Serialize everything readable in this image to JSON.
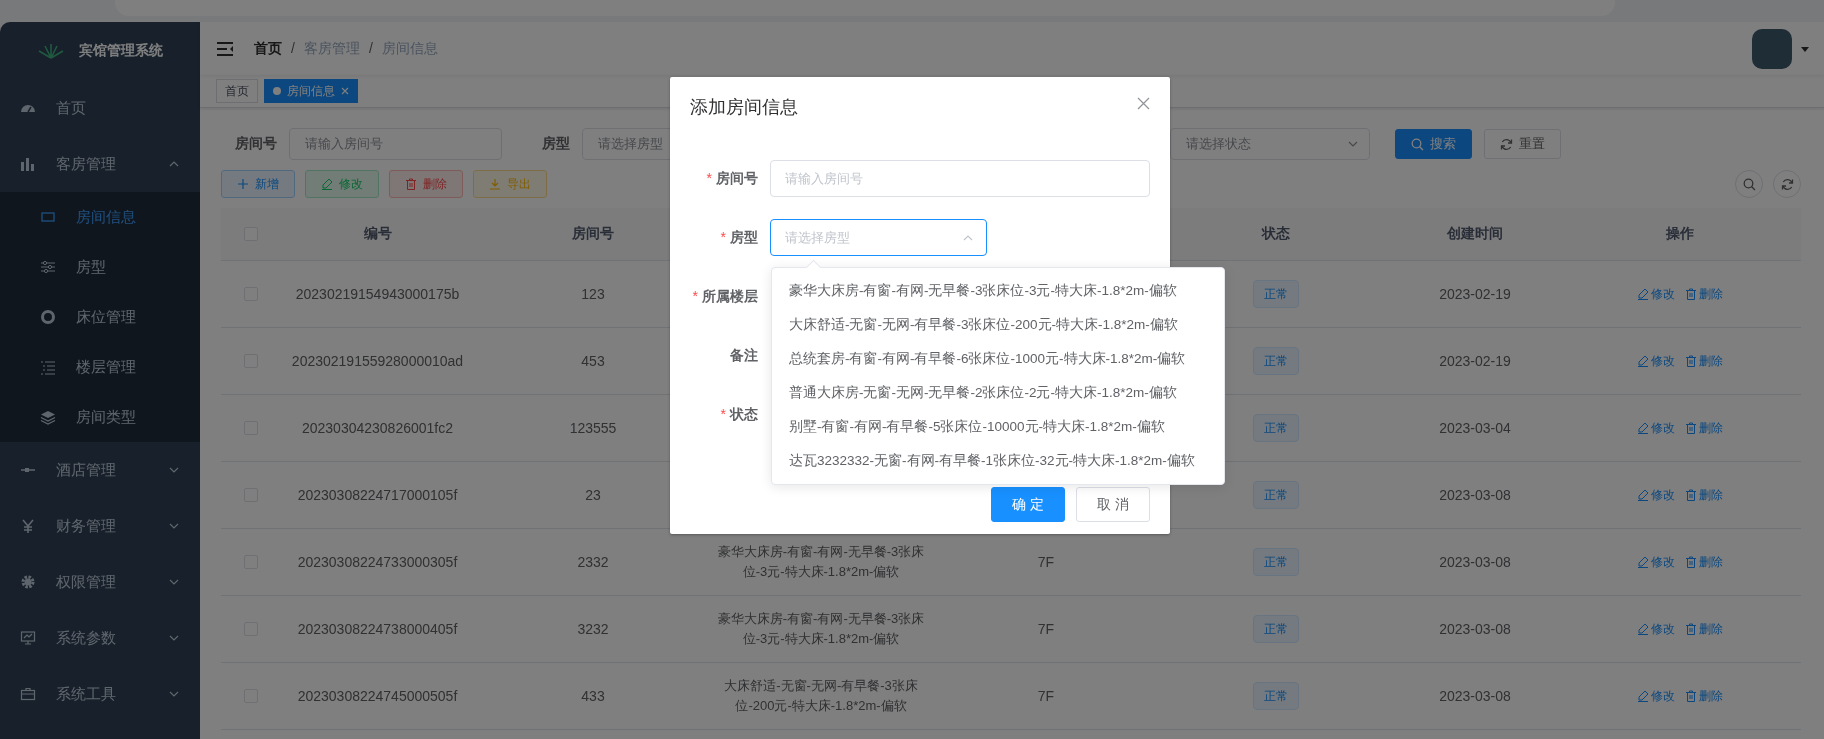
{
  "sidebar": {
    "title": "宾馆管理系统",
    "items": [
      {
        "label": "首页",
        "selected": false
      },
      {
        "label": "客房管理",
        "expanded": true,
        "children": [
          {
            "label": "房间信息",
            "selected": true
          },
          {
            "label": "房型",
            "selected": false
          },
          {
            "label": "床位管理",
            "selected": false
          },
          {
            "label": "楼层管理",
            "selected": false
          },
          {
            "label": "房间类型",
            "selected": false
          }
        ]
      },
      {
        "label": "酒店管理",
        "expanded": false
      },
      {
        "label": "财务管理",
        "expanded": false
      },
      {
        "label": "权限管理",
        "expanded": false
      },
      {
        "label": "系统参数",
        "expanded": false
      },
      {
        "label": "系统工具",
        "expanded": false
      }
    ]
  },
  "header": {
    "breadcrumb": [
      "首页",
      "客房管理",
      "房间信息"
    ],
    "separators": [
      "/",
      "/"
    ]
  },
  "tabs": [
    {
      "label": "首页",
      "selected": false
    },
    {
      "label": "房间信息",
      "selected": true
    }
  ],
  "filters": {
    "fields": [
      {
        "label": "房间号",
        "kind": "input",
        "placeholder": "请输入房间号"
      },
      {
        "label": "房型",
        "kind": "select",
        "placeholder": "请选择房型"
      },
      {
        "kind": "select",
        "placeholder": "请选择状态"
      }
    ],
    "buttons": [
      {
        "label": "搜索",
        "kind": "primary"
      },
      {
        "label": "重置",
        "kind": "default"
      }
    ]
  },
  "toolbar": [
    {
      "label": "新增",
      "kind": "primary"
    },
    {
      "label": "修改",
      "kind": "success"
    },
    {
      "label": "删除",
      "kind": "danger"
    },
    {
      "label": "导出",
      "kind": "warning"
    }
  ],
  "table": {
    "header_checked": false,
    "columns": [
      "编号",
      "房间号",
      "状态",
      "创建时间",
      "操作"
    ],
    "rows": [
      {
        "checked": false,
        "id": "20230219154943000175b",
        "room_no": "123",
        "status": "正常",
        "created": "2023-02-19",
        "actions": [
          "修改",
          "删除"
        ]
      },
      {
        "checked": false,
        "id": "20230219155928000010ad",
        "room_no": "453",
        "status": "正常",
        "created": "2023-02-19",
        "actions": [
          "修改",
          "删除"
        ]
      },
      {
        "checked": false,
        "id": "20230304230826001fc2",
        "room_no": "123555",
        "status": "正常",
        "created": "2023-03-04",
        "actions": [
          "修改",
          "删除"
        ]
      },
      {
        "checked": false,
        "id": "20230308224717000105f",
        "room_no": "23",
        "status": "正常",
        "created": "2023-03-08",
        "actions": [
          "修改",
          "删除"
        ]
      },
      {
        "checked": false,
        "id": "20230308224733000305f",
        "room_no": "2332",
        "room_type": "豪华大床房-有窗-有网-无早餐-3张床位-3元-特大床-1.8*2m-偏软",
        "floor": "7F",
        "status": "正常",
        "created": "2023-03-08",
        "actions": [
          "修改",
          "删除"
        ]
      },
      {
        "checked": false,
        "id": "20230308224738000405f",
        "room_no": "3232",
        "room_type": "豪华大床房-有窗-有网-无早餐-3张床位-3元-特大床-1.8*2m-偏软",
        "floor": "7F",
        "status": "正常",
        "created": "2023-03-08",
        "actions": [
          "修改",
          "删除"
        ]
      },
      {
        "checked": false,
        "id": "20230308224745000505f",
        "room_no": "433",
        "room_type": "大床舒适-无窗-无网-有早餐-3张床位-200元-特大床-1.8*2m-偏软",
        "floor": "7F",
        "status": "正常",
        "created": "2023-03-08",
        "actions": [
          "修改",
          "删除"
        ]
      }
    ]
  },
  "dialog": {
    "title": "添加房间信息",
    "fields": [
      {
        "label": "房间号",
        "required_mark": "*",
        "kind": "input",
        "placeholder": "请输入房间号"
      },
      {
        "label": "房型",
        "required_mark": "*",
        "kind": "select",
        "placeholder": "请选择房型",
        "open": true
      },
      {
        "label": "所属楼层",
        "required_mark": "*",
        "kind": "covered"
      },
      {
        "label": "备注",
        "kind": "covered"
      },
      {
        "label": "状态",
        "required_mark": "*",
        "kind": "covered"
      }
    ],
    "options": [
      {
        "label": "豪华大床房-有窗-有网-无早餐-3张床位-3元-特大床-1.8*2m-偏软",
        "selected": false
      },
      {
        "label": "大床舒适-无窗-无网-有早餐-3张床位-200元-特大床-1.8*2m-偏软",
        "selected": false
      },
      {
        "label": "总统套房-有窗-有网-有早餐-6张床位-1000元-特大床-1.8*2m-偏软",
        "selected": false
      },
      {
        "label": "普通大床房-无窗-无网-无早餐-2张床位-2元-特大床-1.8*2m-偏软",
        "selected": false
      },
      {
        "label": "别墅-有窗-有网-有早餐-5张床位-10000元-特大床-1.8*2m-偏软",
        "selected": false
      },
      {
        "label": "达瓦3232332-无窗-有网-有早餐-1张床位-32元-特大床-1.8*2m-偏软",
        "selected": false
      }
    ],
    "buttons": [
      {
        "label": "确 定",
        "kind": "primary"
      },
      {
        "label": "取 消",
        "kind": "default"
      }
    ]
  }
}
